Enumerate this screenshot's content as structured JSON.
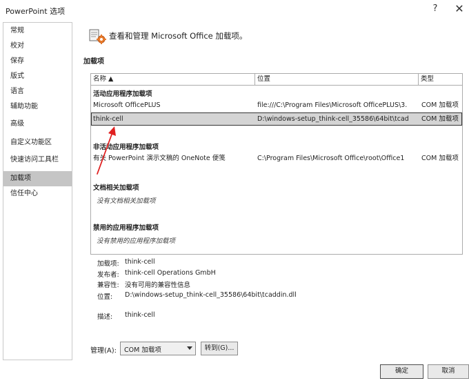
{
  "window": {
    "title": "PowerPoint 选项",
    "help_glyph": "?",
    "close_glyph": "✕"
  },
  "sidebar": {
    "items": [
      {
        "label": "常规",
        "selected": false
      },
      {
        "label": "校对",
        "selected": false
      },
      {
        "label": "保存",
        "selected": false
      },
      {
        "label": "版式",
        "selected": false
      },
      {
        "label": "语言",
        "selected": false
      },
      {
        "label": "辅助功能",
        "selected": false
      },
      {
        "label": "高级",
        "selected": false
      },
      {
        "label": "自定义功能区",
        "selected": false
      },
      {
        "label": "快速访问工具栏",
        "selected": false
      },
      {
        "label": "加载项",
        "selected": true
      },
      {
        "label": "信任中心",
        "selected": false
      }
    ]
  },
  "header": {
    "text": "查看和管理 Microsoft Office 加载项。",
    "icon": "addin-gear-icon"
  },
  "addins_section": {
    "label": "加载项"
  },
  "grid": {
    "columns": [
      {
        "label": "名称 ▲"
      },
      {
        "label": "位置"
      },
      {
        "label": "类型"
      }
    ],
    "groups": {
      "active": "活动应用程序加载项",
      "inactive": "非活动应用程序加载项",
      "document": "文档相关加载项",
      "disabled": "禁用的应用程序加载项"
    },
    "active_rows": [
      {
        "name": "Microsoft OfficePLUS",
        "location": "file:///C:\\Program Files\\Microsoft OfficePLUS\\3.",
        "type": "COM 加载项"
      },
      {
        "name": "think-cell",
        "location": "D:\\windows-setup_think-cell_35586\\64bit\\tcad",
        "type": "COM 加载项"
      }
    ],
    "inactive_rows": [
      {
        "name": "有关 PowerPoint 演示文稿的 OneNote 便笺",
        "location": "C:\\Program Files\\Microsoft Office\\root\\Office1",
        "type": "COM 加载项"
      }
    ],
    "document_empty": "没有文档相关加载项",
    "disabled_empty": "没有禁用的应用程序加载项",
    "selected_row": "think-cell"
  },
  "details": {
    "addin_label": "加载项:",
    "addin_value": "think-cell",
    "publisher_label": "发布者:",
    "publisher_value": "think-cell Operations GmbH",
    "compat_label": "兼容性:",
    "compat_value": "没有可用的兼容性信息",
    "location_label": "位置:",
    "location_value": "D:\\windows-setup_think-cell_35586\\64bit\\tcaddin.dll",
    "desc_label": "描述:",
    "desc_value": "think-cell"
  },
  "manage": {
    "label": "管理(A):",
    "selected": "COM 加载项",
    "go_label": "转到(G)..."
  },
  "footer": {
    "ok_label": "确定",
    "cancel_label": "取消"
  },
  "colors": {
    "selection": "#c5c5c5",
    "arrow": "#e02020",
    "border": "#ababab"
  }
}
